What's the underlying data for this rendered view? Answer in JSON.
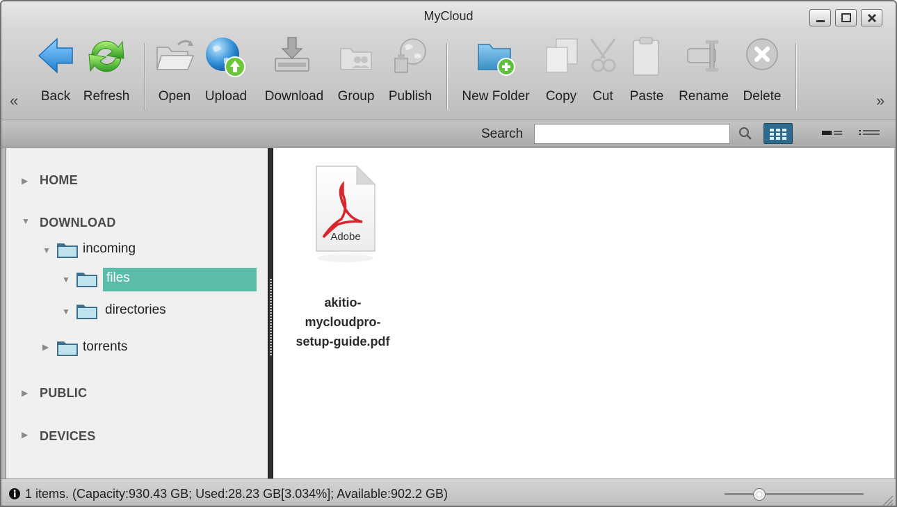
{
  "window": {
    "title": "MyCloud"
  },
  "toolbar": {
    "scroll_left": "«",
    "scroll_right": "»",
    "buttons": {
      "back": "Back",
      "refresh": "Refresh",
      "open": "Open",
      "upload": "Upload",
      "download": "Download",
      "group": "Group",
      "publish": "Publish",
      "new_folder": "New Folder",
      "copy": "Copy",
      "cut": "Cut",
      "paste": "Paste",
      "rename": "Rename",
      "delete": "Delete"
    }
  },
  "search": {
    "label": "Search",
    "value": "",
    "placeholder": ""
  },
  "sidebar": {
    "sections": [
      "HOME",
      "DOWNLOAD",
      "PUBLIC",
      "DEVICES"
    ],
    "folders": {
      "incoming": "incoming",
      "files": "files",
      "directories": "directories",
      "torrents": "torrents"
    },
    "selected": "files"
  },
  "content": {
    "files": [
      {
        "name": "akitio-mycloudpro-setup-guide.pdf",
        "line1": "akitio-",
        "line2": "mycloudpro-",
        "line3": "setup-guide.pdf",
        "icon": "pdf-adobe-icon",
        "icon_text": "Adobe"
      }
    ]
  },
  "status": {
    "text": "1 items. (Capacity:930.43 GB; Used:28.23 GB[3.034%]; Available:902.2 GB)",
    "zoom_level": 0.25
  },
  "colors": {
    "selection": "#5cbcaa",
    "view_active": "#2d6a8c",
    "accent_green": "#5ec03c",
    "accent_blue": "#2f8fd6"
  }
}
